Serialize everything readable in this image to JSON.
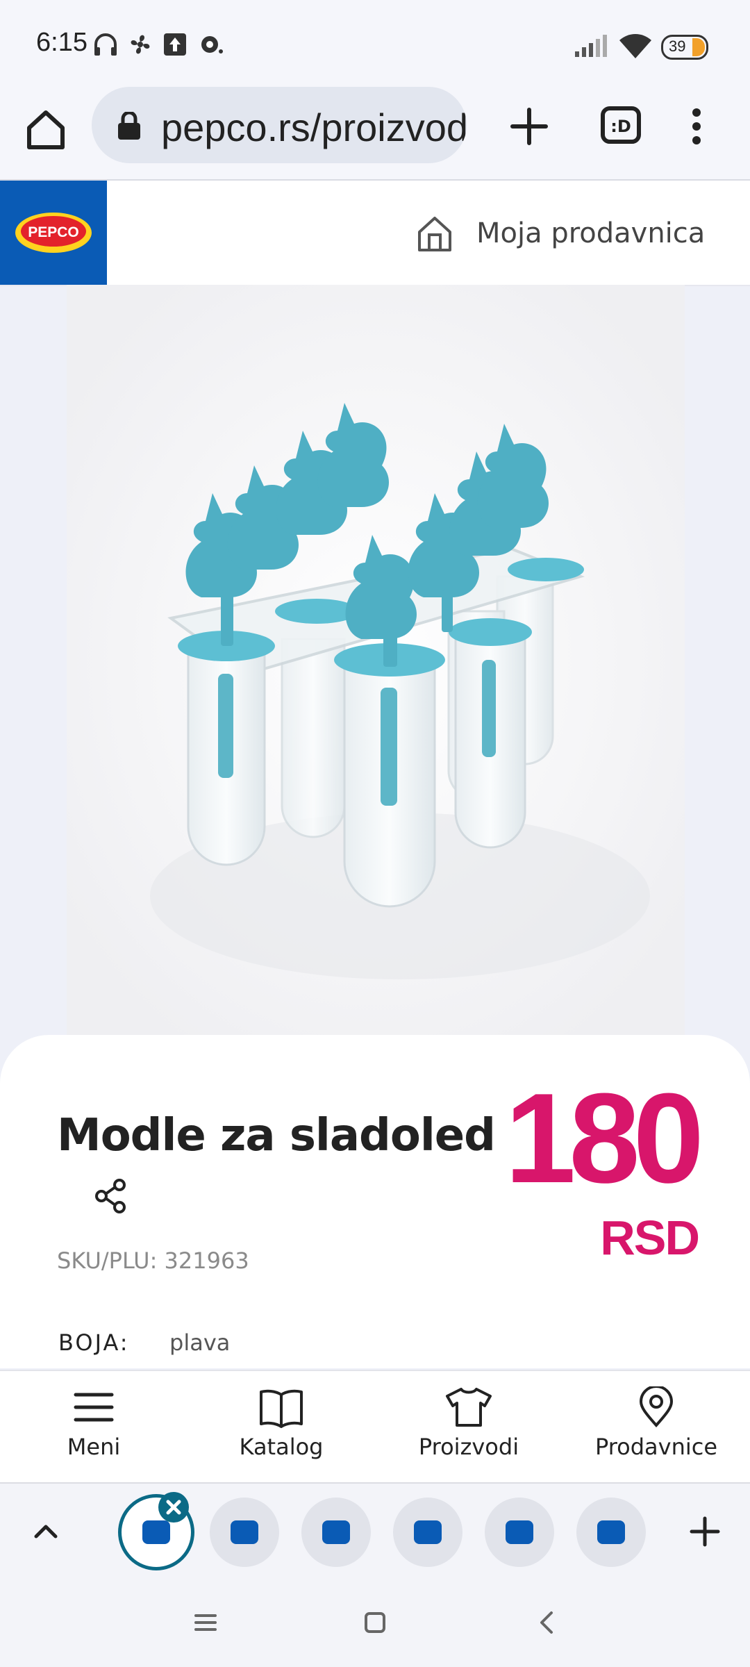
{
  "status_bar": {
    "time": "6:15",
    "battery": "39",
    "icons": [
      "headphones-icon",
      "fan-icon",
      "upload-icon",
      "cast-icon",
      "signal-icon",
      "wifi-icon",
      "battery-icon"
    ]
  },
  "browser": {
    "url": "pepco.rs/proizvodi",
    "icons": [
      "home-icon",
      "lock-icon",
      "plus-icon",
      "tab-switcher-icon",
      "more-vert-icon"
    ]
  },
  "site_header": {
    "logo_text": "PEPCO",
    "store_label": "Moja prodavnica"
  },
  "product": {
    "title": "Modle za sladoled",
    "price": "180",
    "currency": "RSD",
    "sku": "SKU/PLU: 321963",
    "color_label": "BOJA:",
    "color_value": "plava"
  },
  "bottom_nav": [
    {
      "label": "Meni",
      "icon": "menu-icon"
    },
    {
      "label": "Katalog",
      "icon": "book-icon"
    },
    {
      "label": "Proizvodi",
      "icon": "tshirt-icon"
    },
    {
      "label": "Prodavnice",
      "icon": "location-pin-icon"
    }
  ],
  "colors": {
    "brand_blue": "#0a5bb5",
    "price_pink": "#d8166b",
    "active_tab_ring": "#0b6a86"
  }
}
